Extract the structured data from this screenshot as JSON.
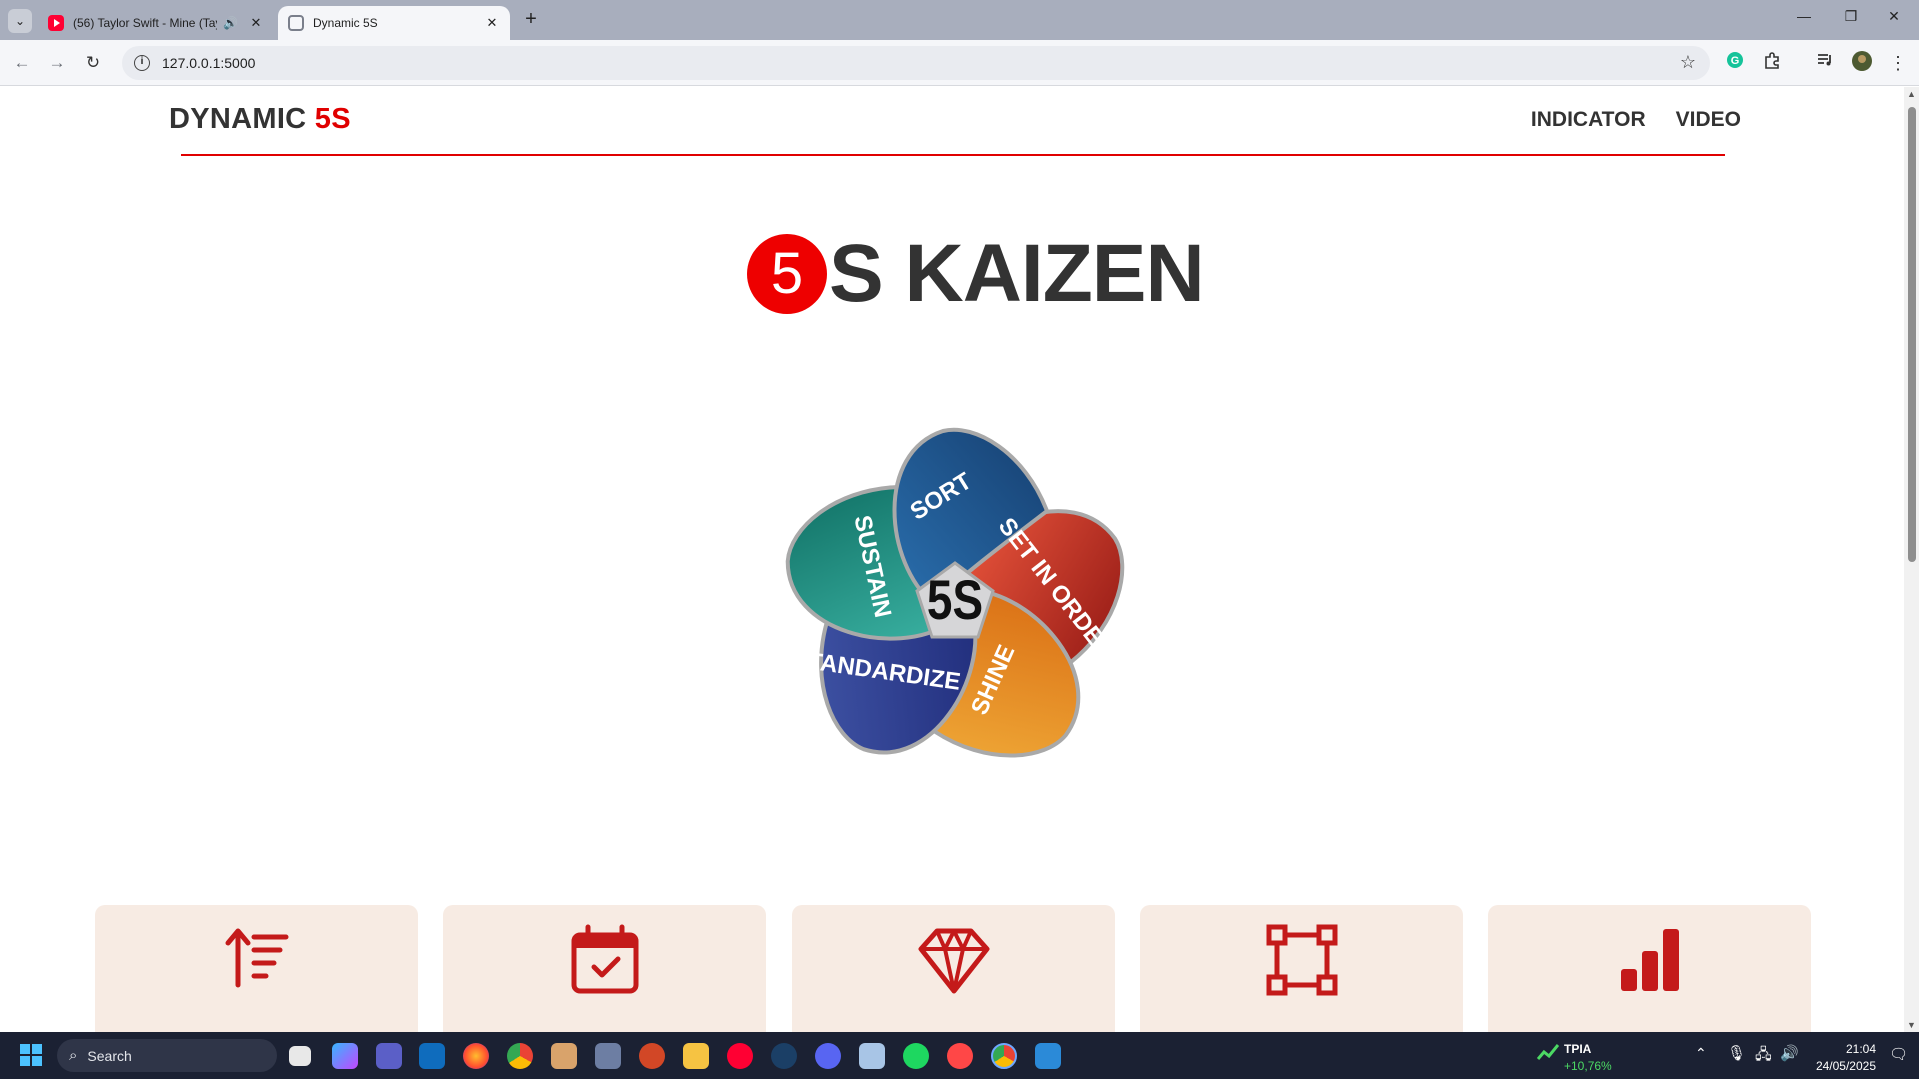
{
  "browser": {
    "tabs": [
      {
        "title": "(56) Taylor Swift - Mine (Tay",
        "icon": "youtube-icon",
        "active": false
      },
      {
        "title": "Dynamic 5S",
        "icon": "globe-icon",
        "active": true
      }
    ],
    "url": "127.0.0.1:5000"
  },
  "header": {
    "brand_main": "DYNAMIC ",
    "brand_accent": "5S",
    "nav": [
      "INDICATOR",
      "VIDEO"
    ]
  },
  "hero": {
    "badge": "5",
    "title_rest": "S KAIZEN"
  },
  "diagram": {
    "center": "5S",
    "petals": [
      {
        "label": "SORT",
        "color": "#c0392b"
      },
      {
        "label": "SET IN ORDER",
        "color": "#e8981f"
      },
      {
        "label": "SHINE",
        "color": "#2b3f8f"
      },
      {
        "label": "STANDARDIZE",
        "color": "#1f9a8a"
      },
      {
        "label": "SUSTAIN",
        "color": "#1f5d99"
      }
    ]
  },
  "cards": [
    {
      "icon": "sort-ascending-icon"
    },
    {
      "icon": "calendar-check-icon"
    },
    {
      "icon": "diamond-icon"
    },
    {
      "icon": "frame-corners-icon"
    },
    {
      "icon": "bar-chart-icon"
    }
  ],
  "taskbar": {
    "search_placeholder": "Search",
    "stock_symbol": "TPIA",
    "stock_change": "+10,76%",
    "time": "21:04",
    "date": "24/05/2025"
  },
  "colors": {
    "accent": "#e00000",
    "card_bg": "#f7ebe3"
  }
}
